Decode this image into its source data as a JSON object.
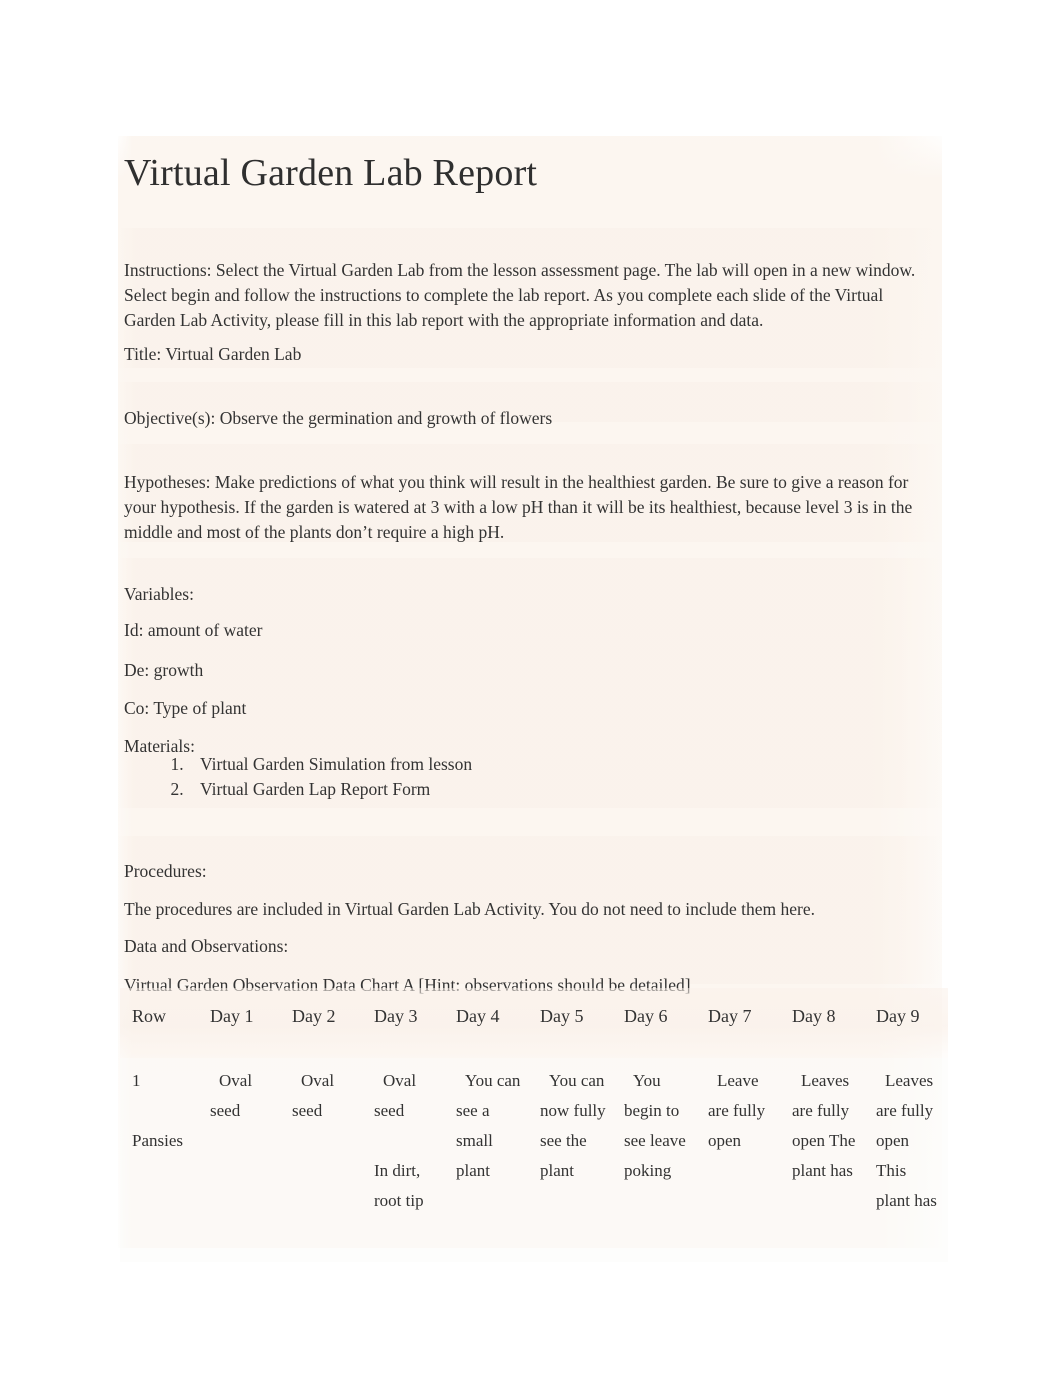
{
  "document": {
    "title": "Virtual Garden Lab Report",
    "instructions": "Instructions: Select the Virtual Garden Lab from the lesson assessment page. The lab will open in a new window. Select begin and follow the instructions to complete the lab report. As you complete each slide of the Virtual Garden Lab Activity, please fill in this lab report with the appropriate information and data.",
    "title_line": "Title: Virtual Garden Lab",
    "objectives": "Objective(s): Observe the germination and growth of flowers",
    "hypotheses": "Hypotheses: Make predictions of what you think will result in the healthiest garden. Be sure to give a reason for your hypothesis. If the garden is watered at 3 with a low pH than it will be its healthiest, because level 3 is in the middle and most of the plants don’t require a high pH.",
    "variables_heading": "Variables:",
    "variable_independent": "Id: amount of water",
    "variable_dependent": "De: growth",
    "variable_controlled": "Co: Type of plant",
    "materials_heading": "Materials:",
    "materials": [
      "Virtual Garden Simulation from lesson",
      "Virtual Garden Lap Report Form"
    ],
    "procedures_heading": "Procedures:",
    "procedures_text": "The procedures are included in Virtual Garden Lab Activity. You do not need to include them here.",
    "data_heading": "Data and Observations:",
    "chart_caption": "Virtual Garden Observation Data Chart A  [Hint: observations should be detailed]"
  },
  "observation_table": {
    "headers": [
      "Row",
      "Day 1",
      "Day 2",
      "Day 3",
      "Day 4",
      "Day 5",
      "Day 6",
      "Day 7",
      "Day 8",
      "Day 9"
    ],
    "rows": [
      {
        "row_label": "1\n\nPansies",
        "day1": "Oval seed",
        "day2": "Oval seed",
        "day3": "Oval seed\n\nIn dirt, root tip",
        "day4": "You can see a small plant",
        "day5": "You can now fully see the plant",
        "day6": "You begin to see leave poking",
        "day7": "Leave are fully open",
        "day8": "Leaves are fully open The plant has",
        "day9": "Leaves are fully open This plant has"
      }
    ]
  },
  "colors": {
    "page_background": "#ffffff",
    "surface_tint": "#fbf5ef",
    "text": "#333333",
    "title_text": "#2f2f2f"
  }
}
